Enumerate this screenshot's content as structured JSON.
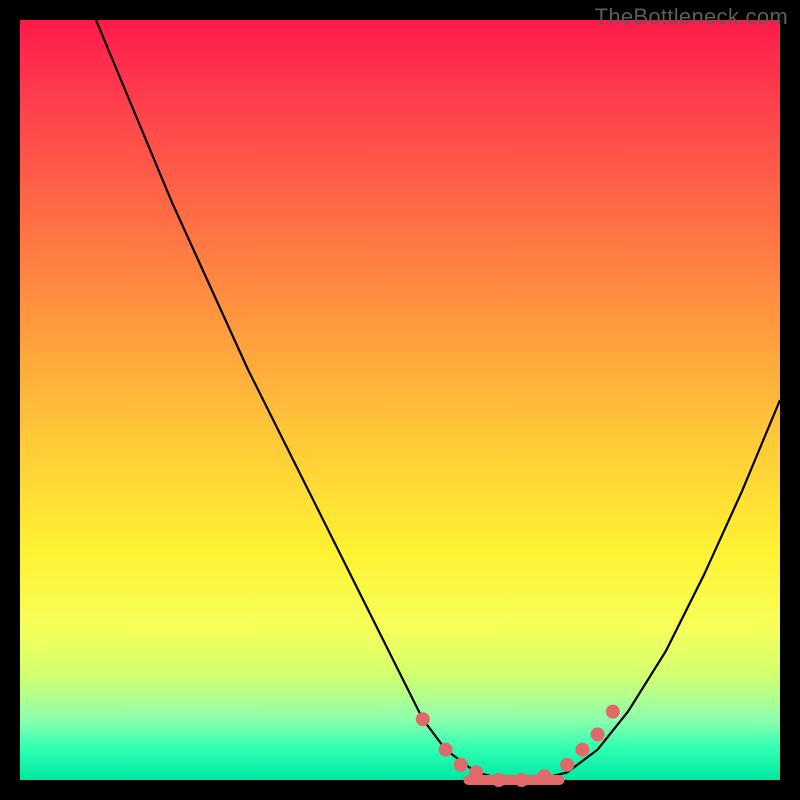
{
  "watermark": "TheBottleneck.com",
  "chart_data": {
    "type": "line",
    "title": "",
    "xlabel": "",
    "ylabel": "",
    "xlim": [
      0,
      100
    ],
    "ylim": [
      0,
      100
    ],
    "grid": false,
    "legend": false,
    "background": "rainbow-gradient-red-to-green",
    "series": [
      {
        "name": "curve",
        "color": "#000000",
        "x": [
          10,
          15,
          20,
          25,
          30,
          35,
          40,
          45,
          50,
          53,
          56,
          60,
          64,
          68,
          72,
          76,
          80,
          85,
          90,
          95,
          100
        ],
        "y": [
          100,
          88,
          76,
          65,
          54,
          44,
          34,
          24,
          14,
          8,
          4,
          1,
          0,
          0,
          1,
          4,
          9,
          17,
          27,
          38,
          50
        ]
      }
    ],
    "markers": {
      "color": "#e06a6a",
      "points": [
        {
          "x": 53,
          "y": 8
        },
        {
          "x": 56,
          "y": 4
        },
        {
          "x": 58,
          "y": 2
        },
        {
          "x": 60,
          "y": 1
        },
        {
          "x": 63,
          "y": 0
        },
        {
          "x": 66,
          "y": 0
        },
        {
          "x": 69,
          "y": 0.5
        },
        {
          "x": 72,
          "y": 2
        },
        {
          "x": 74,
          "y": 4
        },
        {
          "x": 76,
          "y": 6
        },
        {
          "x": 78,
          "y": 9
        }
      ],
      "floor_segment": {
        "x1": 59,
        "x2": 71,
        "y": 0
      }
    }
  }
}
